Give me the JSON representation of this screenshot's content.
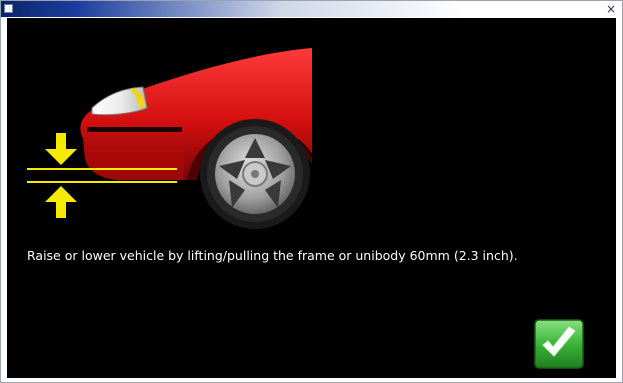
{
  "window": {
    "title": "",
    "close_glyph": "×"
  },
  "illustration": {
    "subject": "car-front-ride-height",
    "colors": {
      "body": "#d41010",
      "headlight": "#f2d21a",
      "arrows": "#f5ea00",
      "tire": "#1a1a1a",
      "rim": "#a8a8a8"
    },
    "icons": [
      "arrow-down-icon",
      "arrow-up-icon",
      "wheel-icon",
      "headlight-icon"
    ]
  },
  "instruction": {
    "text": "Raise or lower vehicle by lifting/pulling the frame or unibody 60mm (2.3 inch)."
  },
  "actions": {
    "ok_icon": "checkmark-icon",
    "ok_color": "#2fa82f"
  }
}
